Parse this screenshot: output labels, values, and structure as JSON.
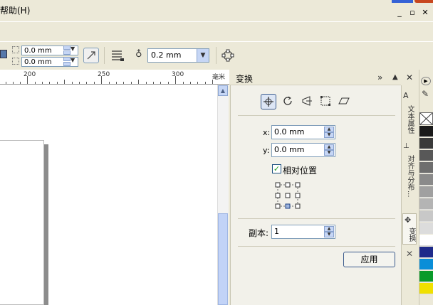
{
  "menu": {
    "help": "帮助(H)"
  },
  "window": {
    "min": "_",
    "restore": "▫",
    "close": "✕"
  },
  "toolbar": {
    "width_value": "0.0 mm",
    "height_value": "0.0 mm",
    "outline_width": "0.2 mm"
  },
  "ruler": {
    "labels": [
      "200",
      "250",
      "300"
    ],
    "unit": "毫米"
  },
  "docker": {
    "title": "变换",
    "expand": "»",
    "collapse": "▲",
    "close": "✕",
    "x_label": "x:",
    "x_value": "0.0 mm",
    "y_label": "y:",
    "y_value": "0.0 mm",
    "relative_label": "相对位置",
    "copies_label": "副本:",
    "copies_value": "1",
    "apply": "应用"
  },
  "tabs": {
    "text_props": "文本属性",
    "align_dist": "对齐与分布...",
    "transform": "变换",
    "close": "✕"
  },
  "palette": {
    "colors": [
      "#1a1a1a",
      "#3a3a3a",
      "#585858",
      "#6e6e6e",
      "#8a8a8a",
      "#a0a0a0",
      "#b4b4b4",
      "#c8c8c8",
      "#dcdcdc",
      "#ffffff",
      "#1e2a8a",
      "#0a8ed8",
      "#0a9a2a",
      "#f0e000"
    ]
  }
}
